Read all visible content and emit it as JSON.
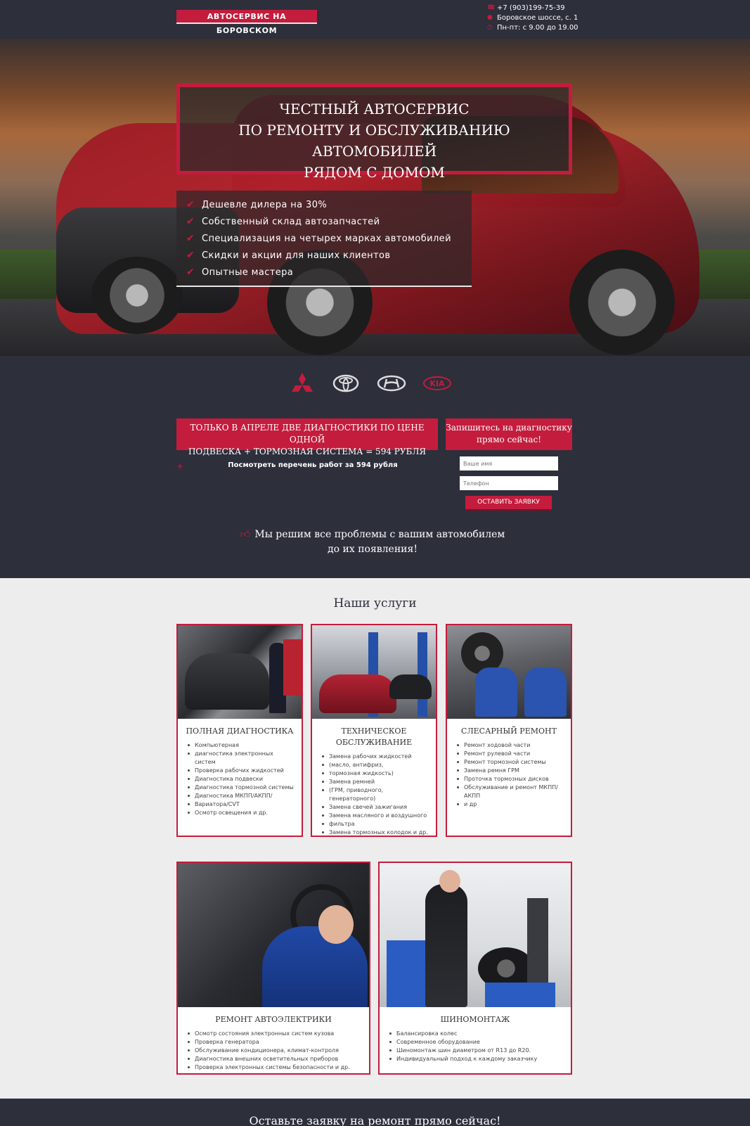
{
  "header": {
    "brand": "АВТОСЕРВИС НА БОРОВСКОМ",
    "phone": "+7 (903)199-75-39",
    "address": "Боровское шоссе, с. 1",
    "hours": "Пн-пт: с 9.00 до 19.00"
  },
  "hero": {
    "title_line1": "ЧЕСТНЫЙ АВТОСЕРВИС",
    "title_line2": "ПО РЕМОНТУ И ОБСЛУЖИВАНИЮ АВТОМОБИЛЕЙ",
    "title_line3": "РЯДОМ С ДОМОМ",
    "benefits": [
      "Дешевле дилера на 30%",
      "Собственный склад автозапчастей",
      "Специализация на четырех марках автомобилей",
      "Скидки и акции для наших клиентов",
      "Опытные мастера"
    ]
  },
  "brands": [
    "mitsubishi-logo",
    "toyota-logo",
    "hyundai-logo",
    "kia-logo"
  ],
  "promo": {
    "line1": "ТОЛЬКО В АПРЕЛЕ ДВЕ ДИАГНОСТИКИ ПО ЦЕНЕ ОДНОЙ",
    "line2": "ПОДВЕСКА + ТОРМОЗНАЯ СИСТЕМА = 594 РУБЛЯ",
    "link": "Посмотреть перечень работ за 594 рубля",
    "plus": "+"
  },
  "signup": {
    "title_line1": "Запишитесь на диагностику",
    "title_line2": "прямо сейчас!",
    "name_placeholder": "Ваше имя",
    "phone_placeholder": "Телефон",
    "submit": "ОСТАВИТЬ ЗАЯВКУ"
  },
  "slogan": {
    "line1": "Мы решим все проблемы с вашим автомобилем",
    "line2": "до их появления!"
  },
  "services": {
    "title": "Наши услуги",
    "cards": [
      {
        "title": "ПОЛНАЯ ДИАГНОСТИКА",
        "items": [
          "Компьютерная",
          "диагностика электронных систем",
          "Проверка рабочих жидкостей",
          "Диагностика подвески",
          "Диагностика тормозной системы",
          "Диагностика МКПП/АКПП/",
          "Вариатора/CVT",
          "Осмотр освещения и др."
        ]
      },
      {
        "title": "ТЕХНИЧЕСКОЕ ОБСЛУЖИВАНИЕ",
        "items": [
          "Замена рабочих жидкостей",
          "(масло, антифриз,",
          "тормозная жидкость)",
          "Замена ремней",
          "(ГРМ, приводного, генераторного)",
          "Замена свечей зажигания",
          "Замена масляного и воздушного",
          "фильтра",
          "Замена тормозных колодок и др."
        ]
      },
      {
        "title": "СЛЕСАРНЫЙ РЕМОНТ",
        "items": [
          "Ремонт ходовой части",
          "Ремонт рулевой части",
          "Ремонт тормозной системы",
          "Замена ремня ГРМ",
          "Проточка тормозных дисков",
          "Обслуживание и ремонт МКПП/АКПП",
          "и др"
        ]
      },
      {
        "title": "РЕМОНТ АВТОЭЛЕКТРИКИ",
        "items": [
          "Осмотр состояния электронных систем кузова",
          "Проверка генератора",
          "Обслуживание кондиционера, климат-контроля",
          "Диагностика внешних осветительных приборов",
          "Проверка электронных системы безопасности и др."
        ]
      },
      {
        "title": "ШИНОМОНТАЖ",
        "items": [
          "Балансировка колес",
          "Современное оборудование",
          "Шиномонтаж шин диаметром от R13 до R20.",
          "Индивидуальный подход к каждому заказчику"
        ]
      }
    ]
  },
  "footer": {
    "cta": "Оставьте заявку на ремонт прямо сейчас!"
  },
  "colors": {
    "accent": "#c41c3d",
    "dark": "#2d2f3b",
    "light": "#ededed"
  }
}
